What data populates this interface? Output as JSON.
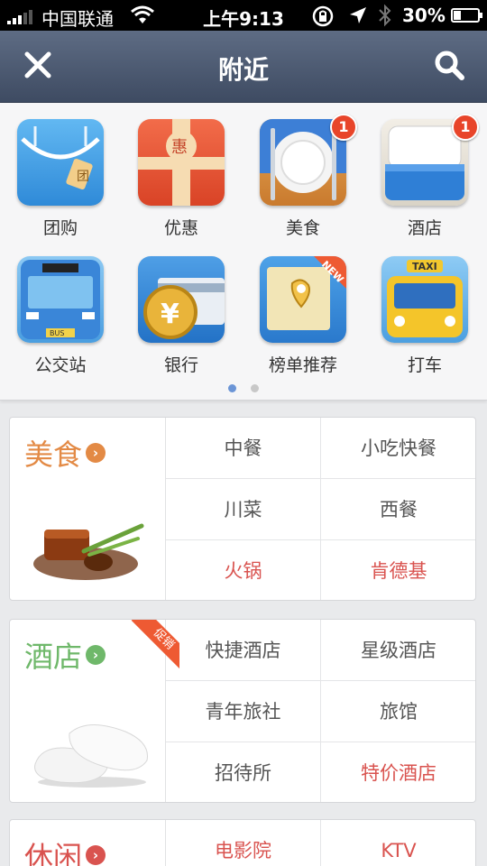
{
  "status_bar": {
    "carrier": "中国联通",
    "time": "上午9:13",
    "battery": "30%"
  },
  "nav": {
    "title": "附近"
  },
  "icon_grid": {
    "items": [
      {
        "label": "团购",
        "icon": "shopping-bag-icon"
      },
      {
        "label": "优惠",
        "icon": "gift-box-icon",
        "icon_text": "惠"
      },
      {
        "label": "美食",
        "icon": "plate-fork-knife-icon",
        "badge": "1"
      },
      {
        "label": "酒店",
        "icon": "hotel-bed-icon",
        "badge": "1"
      },
      {
        "label": "公交站",
        "icon": "bus-icon",
        "icon_text": "BUS"
      },
      {
        "label": "银行",
        "icon": "bank-card-coin-icon",
        "icon_text": "¥"
      },
      {
        "label": "榜单推荐",
        "icon": "ranking-map-icon",
        "ribbon": "NEW"
      },
      {
        "label": "打车",
        "icon": "taxi-icon",
        "icon_text": "TAXI"
      }
    ],
    "page_count": 2,
    "active_page": 1
  },
  "categories": [
    {
      "name": "美食",
      "color": "#e38a45",
      "options": [
        {
          "label": "中餐"
        },
        {
          "label": "小吃快餐"
        },
        {
          "label": "川菜"
        },
        {
          "label": "西餐"
        },
        {
          "label": "火锅",
          "highlight": true
        },
        {
          "label": "肯德基",
          "highlight": true
        }
      ]
    },
    {
      "name": "酒店",
      "color": "#6fb86a",
      "ribbon": "促销",
      "options": [
        {
          "label": "快捷酒店"
        },
        {
          "label": "星级酒店"
        },
        {
          "label": "青年旅社"
        },
        {
          "label": "旅馆"
        },
        {
          "label": "招待所"
        },
        {
          "label": "特价酒店",
          "highlight": true
        }
      ]
    },
    {
      "name": "休闲",
      "color": "#d9534f",
      "options": [
        {
          "label": "电影院",
          "highlight": true
        },
        {
          "label": "KTV",
          "highlight": true
        }
      ]
    }
  ]
}
